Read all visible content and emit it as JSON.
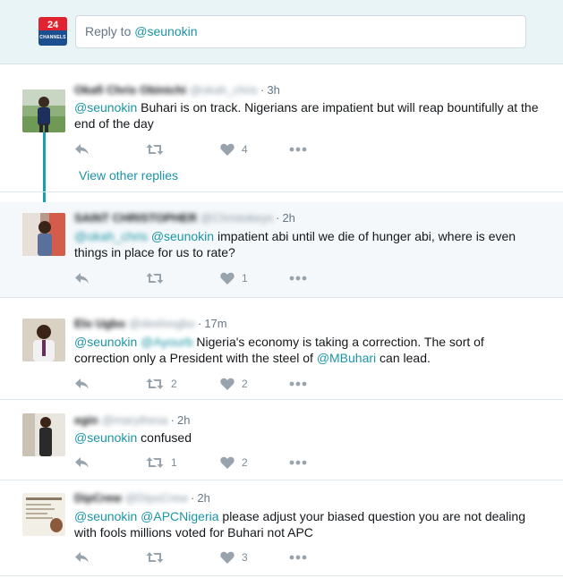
{
  "composer": {
    "logo_number": "24",
    "logo_text": "CHANNELS",
    "reply_prefix": "Reply to ",
    "reply_handle": "@seunokin"
  },
  "icons": {
    "reply": "reply-icon",
    "retweet": "retweet-icon",
    "like": "heart-icon",
    "more": "more-dots-icon"
  },
  "colors": {
    "link": "#1b95a5",
    "thread_line": "#1b9fab",
    "composer_bg": "#e8f4f5"
  },
  "tweets": [
    {
      "name": "Okafi Chris Obinichi",
      "handle": "@okah_chris",
      "time": "3h",
      "mention": "@seunokin",
      "text": " Buhari is on track. Nigerians are impatient but will reap bountifully at the end of the day",
      "retweets": "",
      "likes": "4"
    },
    {
      "name": "SAINT CHRISTOPHER",
      "handle": "@Christokeys",
      "time": "2h",
      "mention_blur": "@okah_chris",
      "mention": "@seunokin",
      "text": " impatient abi until we die of hunger abi, where is even things in place for us to rate?",
      "retweets": "",
      "likes": "1"
    },
    {
      "name": "Elo Ugbo",
      "handle": "@deeloogbo",
      "time": "17m",
      "mention": "@seunokin",
      "mention_blur": "@Ayourb",
      "text_a": " Nigeria's economy is taking a correction. The sort of correction only a President with the steel of ",
      "mention2": "@MBuhari",
      "text_b": " can lead.",
      "retweets": "2",
      "likes": "2"
    },
    {
      "name": "egin",
      "handle": "@marythesa",
      "time": "2h",
      "mention": "@seunokin",
      "text": " confused",
      "retweets": "1",
      "likes": "2"
    },
    {
      "name": "DipCrew",
      "handle": "@DipoCrew",
      "time": "2h",
      "mention": "@seunokin",
      "mention2": "@APCNigeria",
      "text": " please adjust your biased question you are not dealing with fools millions voted for Buhari not APC",
      "retweets": "",
      "likes": "3"
    }
  ],
  "view_other_replies": "View other replies"
}
